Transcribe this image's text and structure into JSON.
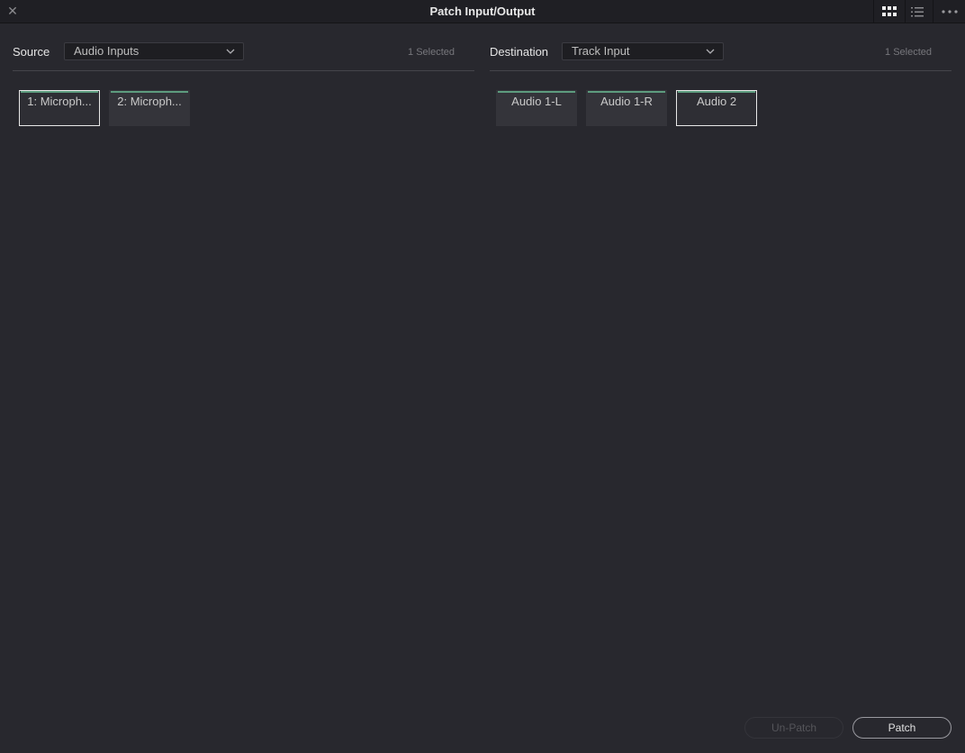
{
  "window": {
    "title": "Patch Input/Output"
  },
  "titlebar": {
    "close_icon": "close-icon",
    "grid_view_icon": "grid-view-icon",
    "list_view_icon": "list-view-icon",
    "more_icon": "more-options-icon"
  },
  "source": {
    "label": "Source",
    "dropdown_value": "Audio Inputs",
    "selected_count": "1 Selected",
    "tiles": [
      {
        "label": "1: Microph...",
        "selected": true
      },
      {
        "label": "2: Microph...",
        "selected": false
      }
    ]
  },
  "destination": {
    "label": "Destination",
    "dropdown_value": "Track Input",
    "selected_count": "1 Selected",
    "tiles": [
      {
        "label": "Audio 1-L",
        "selected": false
      },
      {
        "label": "Audio 1-R",
        "selected": false
      },
      {
        "label": "Audio 2",
        "selected": true
      }
    ]
  },
  "buttons": {
    "unpatch_label": "Un-Patch",
    "patch_label": "Patch"
  },
  "colors": {
    "background": "#28282e",
    "tile_accent": "#5d9c7e",
    "selection_border": "#e8e8e8"
  }
}
